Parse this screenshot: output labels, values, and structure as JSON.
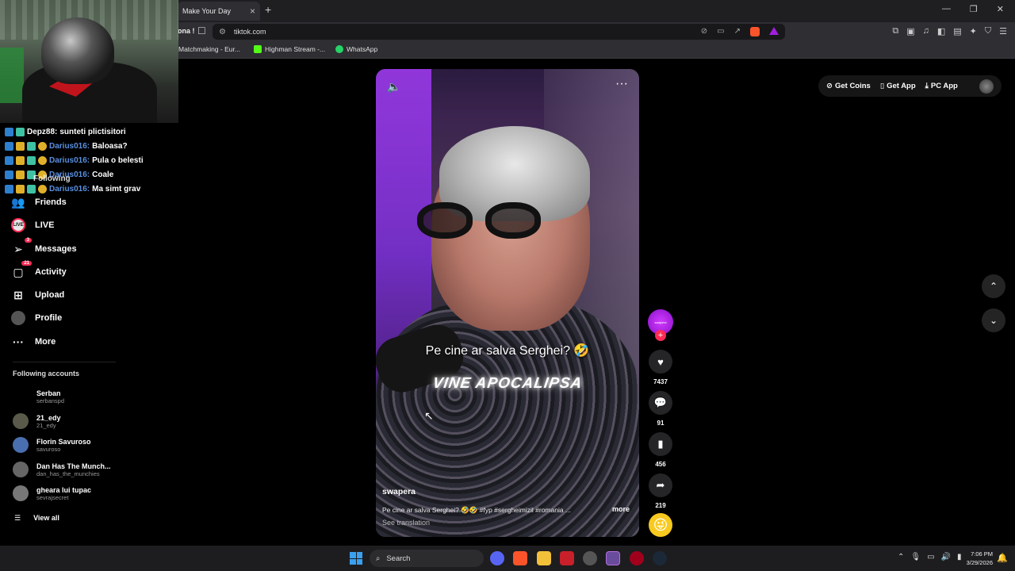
{
  "browser": {
    "tab_title": "Make Your Day",
    "tab_close": "×",
    "new_tab": "+",
    "prev_title": "ona !",
    "url": "tiktok.com",
    "window_controls": [
      "—",
      "❐",
      "✕"
    ]
  },
  "bookmarks": [
    {
      "label": "Matchmaking - Eur...",
      "color": "#e04a2f"
    },
    {
      "label": "Highman Stream -...",
      "color": "#53fc18"
    },
    {
      "label": "WhatsApp",
      "color": "#25d366"
    }
  ],
  "chat": [
    {
      "user": "Depz88:",
      "msg": "sunteti plictisitori",
      "user_color": "#ffffff"
    },
    {
      "user": "Darius016:",
      "msg": "Baloasa?",
      "user_color": "#5a8fe0"
    },
    {
      "user": "Darius016:",
      "msg": "Pula o belesti",
      "user_color": "#5a8fe0"
    },
    {
      "user": "Darius016:",
      "msg": "Coale",
      "user_color": "#5a8fe0"
    },
    {
      "user": "Darius016:",
      "msg": "Ma simt grav",
      "user_color": "#5a8fe0"
    }
  ],
  "sidebar": {
    "following_partial": "Following",
    "items": [
      {
        "label": "Friends",
        "icon": "friends-icon",
        "glyph": "👥"
      },
      {
        "label": "LIVE",
        "icon": "live-icon",
        "glyph": "LIVE"
      },
      {
        "label": "Messages",
        "icon": "messages-icon",
        "glyph": "➢",
        "badge": "3"
      },
      {
        "label": "Activity",
        "icon": "activity-icon",
        "glyph": "💬",
        "badge": "21"
      },
      {
        "label": "Upload",
        "icon": "upload-icon",
        "glyph": "⊞"
      },
      {
        "label": "Profile",
        "icon": "profile-icon",
        "glyph": "●"
      },
      {
        "label": "More",
        "icon": "more-icon",
        "glyph": "···"
      }
    ],
    "following_title": "Following accounts",
    "accounts": [
      {
        "name": "Serban",
        "handle": "serbanspd"
      },
      {
        "name": "21_edy",
        "handle": "21_edy"
      },
      {
        "name": "Florin Savuroso",
        "handle": "savuroso"
      },
      {
        "name": "Dan Has The Munch...",
        "handle": "dan_has_the_munchies"
      },
      {
        "name": "gheara lui tupac",
        "handle": "sevrajsecret"
      }
    ],
    "view_all": "View all"
  },
  "video": {
    "caption": "Pe cine ar salva Serghei? 🤣",
    "subtitle": "VINE APOCALIPSA",
    "author": "swapera",
    "description": "Pe cine ar salva Serghei? 🤣🤣 #fyp #sergheimizil #romania ...",
    "more": "more",
    "see_translation": "See translation"
  },
  "actions": {
    "likes": "7437",
    "comments": "91",
    "saves": "456",
    "shares": "219"
  },
  "header": {
    "get_coins": "Get Coins",
    "get_app": "Get App",
    "pc_app": "PC App"
  },
  "taskbar": {
    "search_placeholder": "Search",
    "time": "7:06 PM",
    "date": "3/29/2026"
  }
}
